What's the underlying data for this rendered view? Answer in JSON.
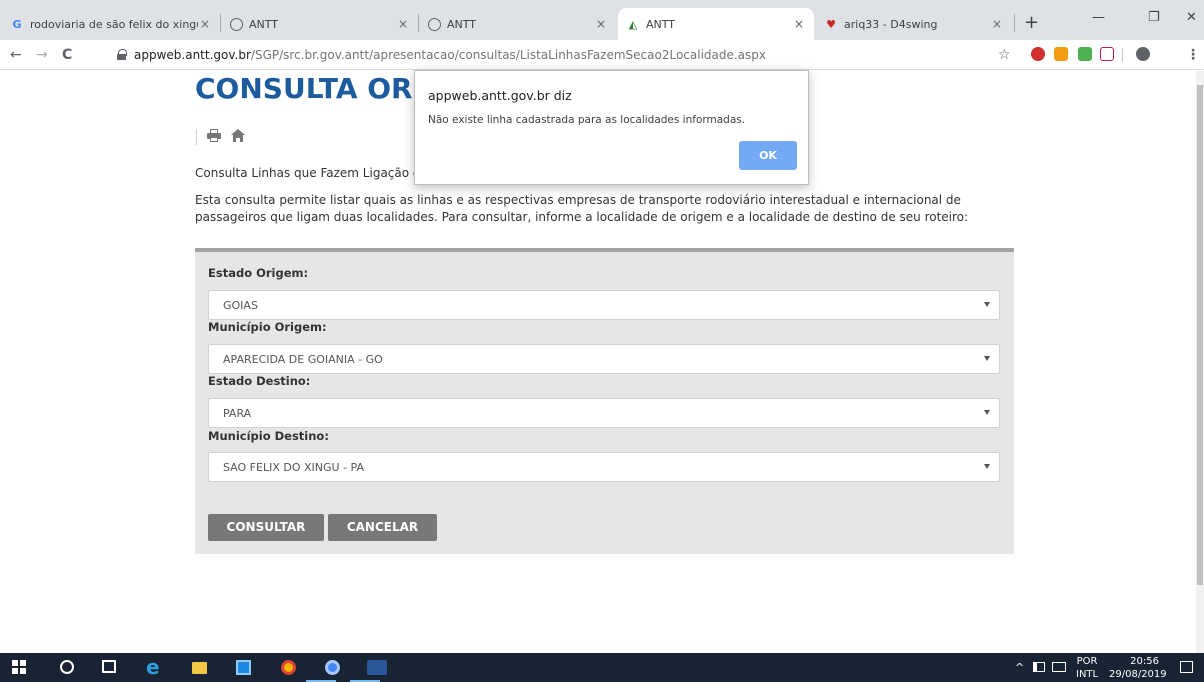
{
  "browser": {
    "tabs": [
      {
        "title": "rodoviaria de são felix do xingu",
        "icon": "google-icon"
      },
      {
        "title": "ANTT",
        "icon": "globe-icon"
      },
      {
        "title": "ANTT",
        "icon": "globe-icon"
      },
      {
        "title": "ANTT",
        "icon": "antt-icon"
      },
      {
        "title": "ariq33 - D4swing",
        "icon": "heart-icon"
      }
    ],
    "new_tab_symbol": "+",
    "close_symbol": "×",
    "url_domain": "appweb.antt.gov.br",
    "url_path": "/SGP/src.br.gov.antt/apresentacao/consultas/ListaLinhasFazemSecao2Localidade.aspx",
    "nav": {
      "back": "←",
      "forward": "→",
      "reload": "C",
      "star": "☆",
      "menu": "⋮"
    },
    "window": {
      "minimize": "—",
      "maximize": "❐",
      "close": "✕"
    }
  },
  "page": {
    "heading": "CONSULTA ORIG",
    "subtitle": "Consulta Linhas que Fazem Ligação en",
    "description": "Esta consulta permite listar quais as linhas e as respectivas empresas de transporte rodoviário interestadual e internacional de passageiros que ligam duas localidades. Para consultar, informe a localidade de origem e a localidade de destino de seu roteiro:",
    "form": {
      "fields": [
        {
          "label": "Estado Origem:",
          "value": "GOIAS"
        },
        {
          "label": "Município Origem:",
          "value": "APARECIDA DE GOIANIA - GO"
        },
        {
          "label": "Estado Destino:",
          "value": "PARA"
        },
        {
          "label": "Município Destino:",
          "value": "SAO FELIX DO XINGU - PA"
        }
      ],
      "submit_label": "CONSULTAR",
      "cancel_label": "CANCELAR"
    }
  },
  "dialog": {
    "title": "appweb.antt.gov.br diz",
    "message": "Não existe linha cadastrada para as localidades informadas.",
    "ok_label": "OK"
  },
  "taskbar": {
    "language_top": "POR",
    "language_bottom": "INTL",
    "time": "20:56",
    "date": "29/08/2019"
  },
  "colors": {
    "heading": "#1c5c9e",
    "button": "#787878",
    "ok_button": "#73a9f5",
    "taskbar": "#182433"
  }
}
